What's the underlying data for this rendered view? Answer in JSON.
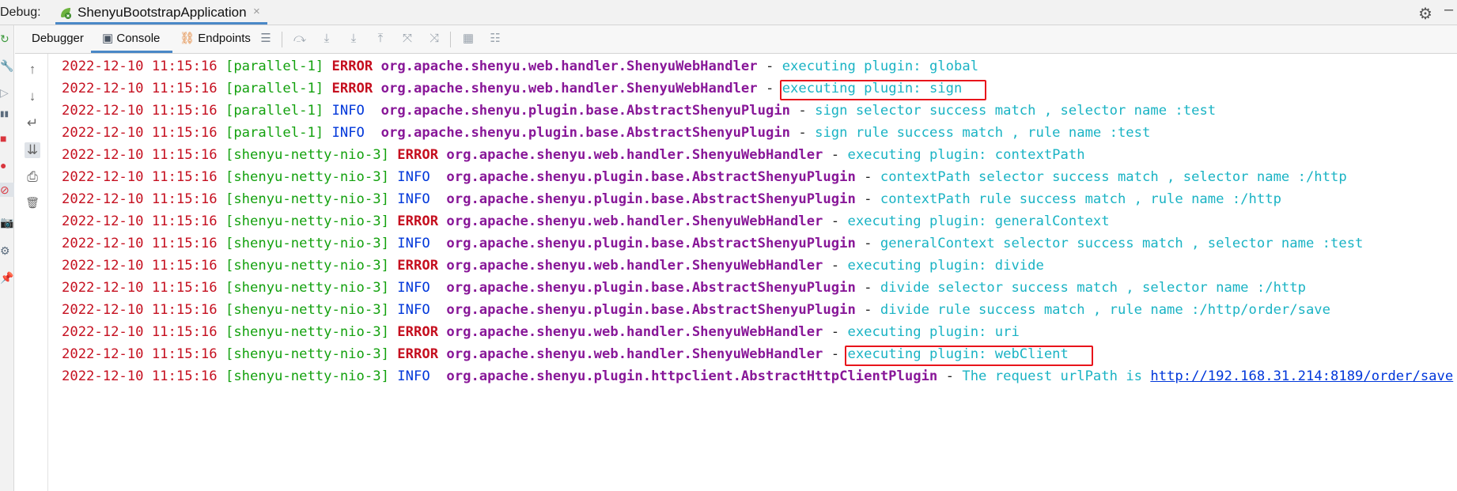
{
  "window": {
    "debug_label": "Debug:",
    "run_tab": "ShenyuBootstrapApplication",
    "close_glyph": "×",
    "gear_glyph": "⚙",
    "minimize_glyph": "–"
  },
  "toolbar": {
    "tabs": [
      {
        "label": "Debugger"
      },
      {
        "label": "Console"
      },
      {
        "label": "Endpoints"
      }
    ],
    "console_icon": "▣",
    "endpoints_icon": "⛓",
    "buttons": [
      "☰",
      "⤼",
      "⤓",
      "⤓",
      "⤒",
      "⤧",
      "⤨",
      "▦",
      "☷"
    ]
  },
  "side_actions": [
    "↑",
    "↓",
    "↵",
    "⇊",
    "⎙",
    "🗑"
  ],
  "left_strip_icons": [
    "↻",
    "🔧",
    "▷",
    "▮▮",
    "■",
    "●",
    "⊘",
    "📷",
    "⚙",
    "📌"
  ],
  "colors": {
    "timestamp": "#c50f1f",
    "thread": "#13a10e",
    "error": "#c50f1f",
    "info": "#0037da",
    "logger": "#881798",
    "message": "#1ab3c4",
    "highlight_box": "#e8141b",
    "accent": "#4a88c7"
  },
  "console": {
    "lines": [
      {
        "time": "2022-12-10 11:15:16",
        "thread": "[parallel-1]",
        "level": "ERROR",
        "logger": "org.apache.shenyu.web.handler.ShenyuWebHandler",
        "dash": "-",
        "message": "executing plugin: global"
      },
      {
        "time": "2022-12-10 11:15:16",
        "thread": "[parallel-1]",
        "level": "ERROR",
        "logger": "org.apache.shenyu.web.handler.ShenyuWebHandler",
        "dash": "-",
        "message": "executing plugin: sign",
        "highlight": true
      },
      {
        "time": "2022-12-10 11:15:16",
        "thread": "[parallel-1]",
        "level": "INFO ",
        "logger": "org.apache.shenyu.plugin.base.AbstractShenyuPlugin",
        "dash": "-",
        "message": "sign selector success match , selector name :test"
      },
      {
        "time": "2022-12-10 11:15:16",
        "thread": "[parallel-1]",
        "level": "INFO ",
        "logger": "org.apache.shenyu.plugin.base.AbstractShenyuPlugin",
        "dash": "-",
        "message": "sign rule success match , rule name :test"
      },
      {
        "time": "2022-12-10 11:15:16",
        "thread": "[shenyu-netty-nio-3]",
        "level": "ERROR",
        "logger": "org.apache.shenyu.web.handler.ShenyuWebHandler",
        "dash": "-",
        "message": "executing plugin: contextPath"
      },
      {
        "time": "2022-12-10 11:15:16",
        "thread": "[shenyu-netty-nio-3]",
        "level": "INFO ",
        "logger": "org.apache.shenyu.plugin.base.AbstractShenyuPlugin",
        "dash": "-",
        "message": "contextPath selector success match , selector name :/http"
      },
      {
        "time": "2022-12-10 11:15:16",
        "thread": "[shenyu-netty-nio-3]",
        "level": "INFO ",
        "logger": "org.apache.shenyu.plugin.base.AbstractShenyuPlugin",
        "dash": "-",
        "message": "contextPath rule success match , rule name :/http"
      },
      {
        "time": "2022-12-10 11:15:16",
        "thread": "[shenyu-netty-nio-3]",
        "level": "ERROR",
        "logger": "org.apache.shenyu.web.handler.ShenyuWebHandler",
        "dash": "-",
        "message": "executing plugin: generalContext"
      },
      {
        "time": "2022-12-10 11:15:16",
        "thread": "[shenyu-netty-nio-3]",
        "level": "INFO ",
        "logger": "org.apache.shenyu.plugin.base.AbstractShenyuPlugin",
        "dash": "-",
        "message": "generalContext selector success match , selector name :test"
      },
      {
        "time": "2022-12-10 11:15:16",
        "thread": "[shenyu-netty-nio-3]",
        "level": "ERROR",
        "logger": "org.apache.shenyu.web.handler.ShenyuWebHandler",
        "dash": "-",
        "message": "executing plugin: divide"
      },
      {
        "time": "2022-12-10 11:15:16",
        "thread": "[shenyu-netty-nio-3]",
        "level": "INFO ",
        "logger": "org.apache.shenyu.plugin.base.AbstractShenyuPlugin",
        "dash": "-",
        "message": "divide selector success match , selector name :/http"
      },
      {
        "time": "2022-12-10 11:15:16",
        "thread": "[shenyu-netty-nio-3]",
        "level": "INFO ",
        "logger": "org.apache.shenyu.plugin.base.AbstractShenyuPlugin",
        "dash": "-",
        "message": "divide rule success match , rule name :/http/order/save"
      },
      {
        "time": "2022-12-10 11:15:16",
        "thread": "[shenyu-netty-nio-3]",
        "level": "ERROR",
        "logger": "org.apache.shenyu.web.handler.ShenyuWebHandler",
        "dash": "-",
        "message": "executing plugin: uri"
      },
      {
        "time": "2022-12-10 11:15:16",
        "thread": "[shenyu-netty-nio-3]",
        "level": "ERROR",
        "logger": "org.apache.shenyu.web.handler.ShenyuWebHandler",
        "dash": "-",
        "message": "executing plugin: webClient",
        "highlight": true
      },
      {
        "time": "2022-12-10 11:15:16",
        "thread": "[shenyu-netty-nio-3]",
        "level": "INFO ",
        "logger": "org.apache.shenyu.plugin.httpclient.AbstractHttpClientPlugin",
        "dash": "-",
        "message": "The request urlPath is ",
        "link": "http://192.168.31.214:8189/order/save"
      }
    ]
  }
}
